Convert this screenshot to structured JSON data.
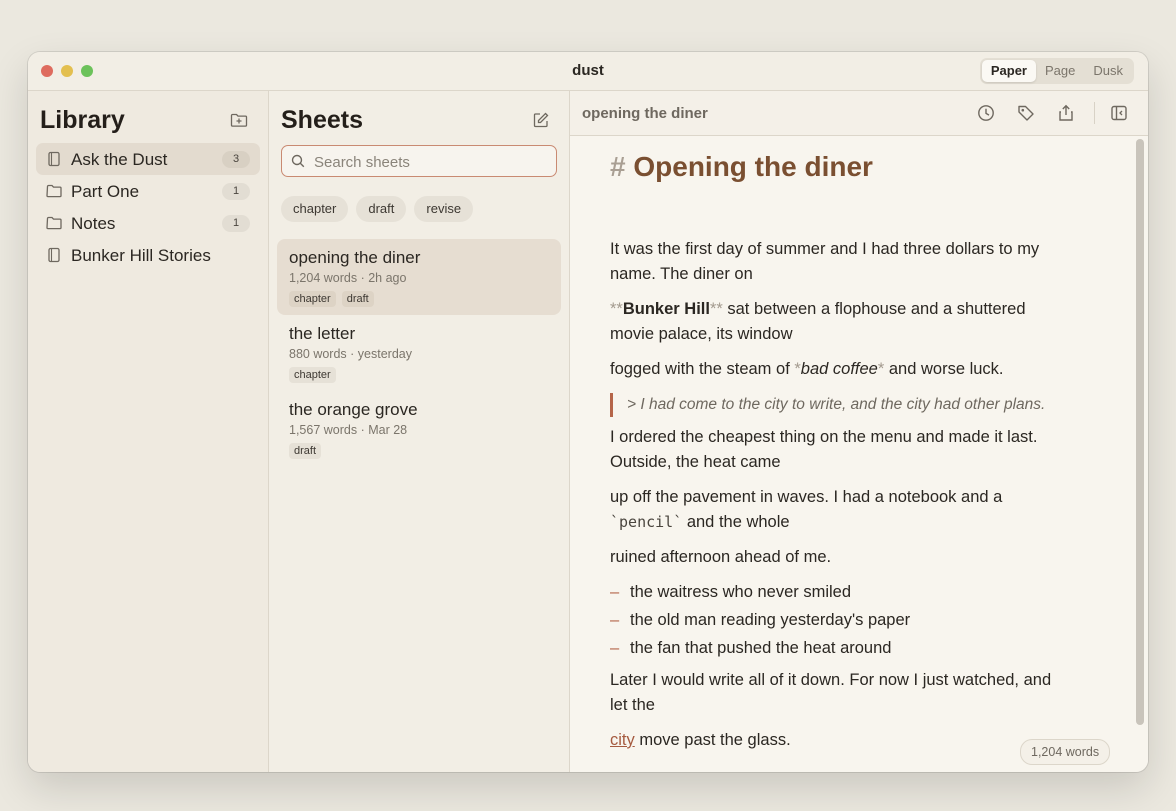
{
  "window": {
    "title": "dust",
    "themes": [
      "Paper",
      "Page",
      "Dusk"
    ],
    "active_theme": "Paper"
  },
  "library": {
    "title": "Library",
    "items": [
      {
        "label": "Ask the Dust",
        "count": "3",
        "icon": "book-icon",
        "selected": true
      },
      {
        "label": "Part One",
        "count": "1",
        "icon": "folder-icon"
      },
      {
        "label": "Notes",
        "count": "1",
        "icon": "folder-icon"
      },
      {
        "label": "Bunker Hill Stories",
        "count": "",
        "icon": "book-icon"
      }
    ]
  },
  "sheets": {
    "title": "Sheets",
    "search_placeholder": "Search sheets",
    "filter_chips": [
      "chapter",
      "draft",
      "revise"
    ],
    "items": [
      {
        "title": "opening the diner",
        "words": "1,204 words",
        "time": "2h ago",
        "tags": [
          "chapter",
          "draft"
        ],
        "selected": true
      },
      {
        "title": "the letter",
        "words": "880 words",
        "time": "yesterday",
        "tags": [
          "chapter"
        ]
      },
      {
        "title": "the orange grove",
        "words": "1,567 words",
        "time": "Mar 28",
        "tags": [
          "draft"
        ]
      }
    ]
  },
  "editor": {
    "header_title": "opening the diner",
    "heading_hash": "#",
    "heading": "Opening the diner",
    "p1_line1": "It was the first day of summer and I had three dollars to my",
    "p1_line2": "name. The diner on",
    "p2_bold": "Bunker Hill",
    "p2_rest": " sat between a flophouse and a shuttered",
    "p2_line2": "movie palace, its window",
    "p3_pre": "fogged with the steam of ",
    "p3_italic": "bad coffee",
    "p3_post": " and worse luck.",
    "quote": "> I had come to the city to write, and the city had other plans.",
    "p4_line1": "I ordered the cheapest thing on the menu and made it last.",
    "p4_line2": "Outside, the heat came",
    "p5_line1": "up off the pavement in waves. I had a notebook and a",
    "p5_code": "`pencil`",
    "p5_post": " and the whole",
    "p6": "ruined afternoon ahead of me.",
    "bullet_marker": "–",
    "bullets": [
      "the waitress who never smiled",
      "the old man reading yesterday's paper",
      "the fan that pushed the heat around"
    ],
    "p7_line1": "Later I would write all of it down. For now I just watched, and",
    "p7_line2": "let the",
    "p8_link": "city",
    "p8_rest": " move past the glass.",
    "word_count": "1,204 words"
  }
}
